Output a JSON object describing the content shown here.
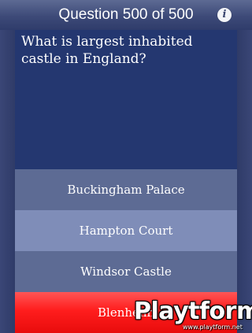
{
  "header": {
    "title": "Question 500 of 500",
    "info_icon": "info-icon",
    "info_glyph": "i"
  },
  "question": {
    "text": "What is largest inhabited castle in England?"
  },
  "answers": [
    {
      "label": "Buckingham Palace"
    },
    {
      "label": "Hampton Court"
    },
    {
      "label": "Windsor Castle"
    },
    {
      "label": "Blenheim"
    }
  ],
  "watermark": {
    "brand": "Playtform",
    "url": "www.playtform.net"
  },
  "colors": {
    "header": "#3d4a78",
    "question_panel": "#243770",
    "answer_default": "#5d6b94",
    "answer_highlight": "#7f8db8",
    "answer_selected_red": "#ff1d1d"
  }
}
